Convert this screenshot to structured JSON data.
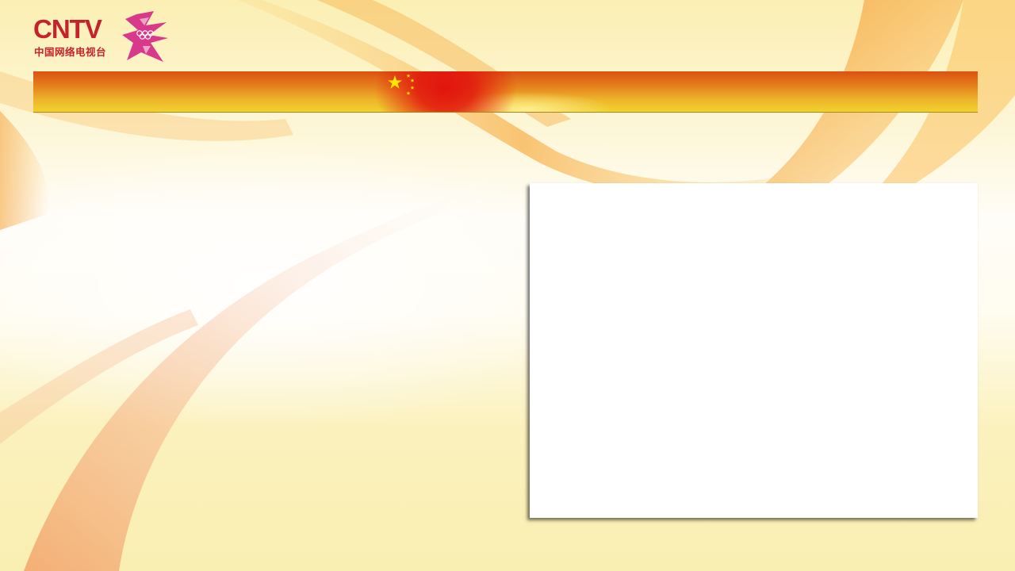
{
  "header": {
    "logo": {
      "brand_text": "CNTV",
      "brand_subtitle": "中国网络电视台",
      "emblem_icon": "london-2012-olympic-emblem-icon"
    },
    "banner": {
      "icon": "china-flag-stars-icon"
    }
  },
  "colors": {
    "brand_red": "#c6222b",
    "emblem_magenta": "#d9398a",
    "banner_top": "#db5212",
    "banner_bottom": "#f1d22c",
    "flag_red": "#e2140e",
    "star_yellow": "#ffe600",
    "background": "#fbf3bf",
    "panel": "#ffffff"
  }
}
